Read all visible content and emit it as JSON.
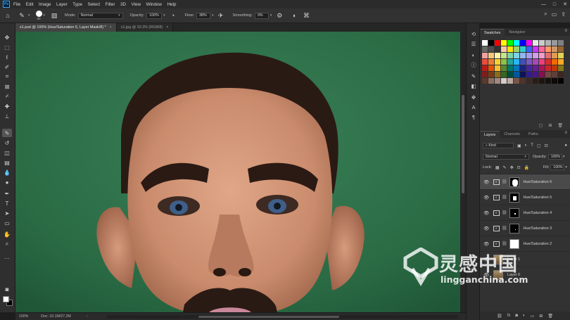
{
  "menu": [
    "File",
    "Edit",
    "Image",
    "Layer",
    "Type",
    "Select",
    "Filter",
    "3D",
    "View",
    "Window",
    "Help"
  ],
  "options_bar": {
    "brush_size": "20",
    "mode_label": "Mode:",
    "mode_value": "Normal",
    "opacity_label": "Opacity:",
    "opacity_value": "100%",
    "flow_label": "Flow:",
    "flow_value": "38%",
    "smoothing_label": "Smoothing:",
    "smoothing_value": "0%"
  },
  "tabs": [
    {
      "title": "s1.psd @ 100% (Hue/Saturation 6, Layer Mask/8) *",
      "active": true
    },
    {
      "title": "s1.jpg @ 33.3% (RGB/8)",
      "active": false
    }
  ],
  "status": {
    "zoom": "100%",
    "doc": "Doc: 10.1M/27.2M"
  },
  "swatches_panel": {
    "tabs": [
      "Swatches",
      "Navigator"
    ],
    "colors": [
      "#ffffff",
      "#000000",
      "#ff0000",
      "#ffff00",
      "#00ff00",
      "#00ffff",
      "#0000ff",
      "#ff00ff",
      "#e6e6e6",
      "#cccccc",
      "#b3b3b3",
      "#999999",
      "#808080",
      "#666666",
      "#4d4d4d",
      "#333333",
      "#f7c9a8",
      "#ffe600",
      "#9dd36a",
      "#33cccc",
      "#3366ff",
      "#cc33ff",
      "#ff6699",
      "#ff9966",
      "#cc9966",
      "#996633",
      "#f2a1a1",
      "#f5c77e",
      "#fff4a3",
      "#c6e48b",
      "#7fd1a7",
      "#7fd3e0",
      "#8fb8f0",
      "#a79cf0",
      "#d39ce8",
      "#f09cc9",
      "#e07070",
      "#e09b57",
      "#e3d157",
      "#e84c3d",
      "#ee7d2f",
      "#f5d02f",
      "#8bc34a",
      "#26a69a",
      "#29b6f6",
      "#3f51b5",
      "#7e57c2",
      "#ab47bc",
      "#ec407a",
      "#d32f2f",
      "#ef6c00",
      "#f9a825",
      "#b71c1c",
      "#e65100",
      "#fbc02d",
      "#558b2f",
      "#00796b",
      "#0277bd",
      "#1a237e",
      "#4527a0",
      "#6a1b9a",
      "#ad1457",
      "#c62828",
      "#bf360c",
      "#827717",
      "#7f1d1d",
      "#7a3a12",
      "#8a6d1a",
      "#33691e",
      "#004d40",
      "#01579b",
      "#0d1452",
      "#311b92",
      "#4a148c",
      "#880e4f",
      "#6d4c41",
      "#5d4037",
      "#3e2723",
      "#5a3a2a",
      "#8d6e63",
      "#a1887f",
      "#d7ccc8",
      "#bcaaa4",
      "#795548",
      "#4e342e",
      "#3b2a22",
      "#2a1c16",
      "#1f1410",
      "#15100c",
      "#0d0a08",
      "#050403"
    ]
  },
  "layers_panel": {
    "tabs": [
      "Layers",
      "Channels",
      "Paths"
    ],
    "filter_kind": "Kind",
    "blend_mode": "Normal",
    "opacity_label": "Opacity:",
    "opacity_value": "100%",
    "lock_label": "Lock:",
    "fill_label": "Fill:",
    "fill_value": "100%",
    "layers": [
      {
        "name": "Hue/Saturation 6",
        "selected": true
      },
      {
        "name": "Hue/Saturation 5",
        "selected": false
      },
      {
        "name": "Hue/Saturation 4",
        "selected": false
      },
      {
        "name": "Hue/Saturation 3",
        "selected": false
      },
      {
        "name": "Hue/Saturation 2",
        "selected": false
      },
      {
        "name": "Layer 1",
        "selected": false
      },
      {
        "name": "Layer 0",
        "selected": false
      }
    ]
  },
  "watermark": {
    "cn": "灵感中国",
    "url": "lingganchina.com"
  }
}
